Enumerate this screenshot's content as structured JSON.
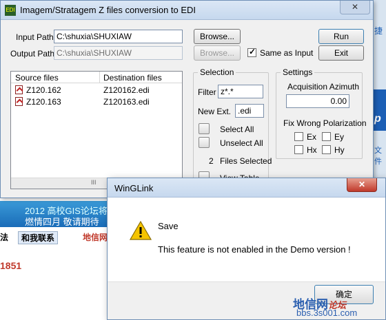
{
  "main_window": {
    "title": "Imagem/Stratagem Z files conversion to EDI",
    "close": "✕",
    "input_path_label": "Input Path",
    "input_path_value": "C:\\shuxia\\SHUXIAW",
    "output_path_label": "Output Path",
    "output_path_value": "C:\\shuxia\\SHUXIAW",
    "browse_input": "Browse...",
    "browse_output": "Browse...",
    "run": "Run",
    "exit": "Exit",
    "same_as_input": "Same as Input",
    "columns": [
      "Source files",
      "Destination files"
    ],
    "files": [
      {
        "source": "Z120.162",
        "dest": "Z120162.edi"
      },
      {
        "source": "Z120.163",
        "dest": "Z120163.edi"
      }
    ],
    "scroll_mark": "III",
    "selection": {
      "title": "Selection",
      "filter_label": "Filter",
      "filter_value": "z*.*",
      "new_ext_label": "New Ext.",
      "new_ext_value": ".edi",
      "select_all": "Select All",
      "unselect_all": "Unselect All",
      "selected_count": "2",
      "files_selected": "Files Selected",
      "view_table": "View Table"
    },
    "settings": {
      "title": "Settings",
      "acq_label": "Acquisition Azimuth",
      "acq_value": "0.00",
      "fix_label": "Fix Wrong Polarization",
      "ex": "Ex",
      "ey": "Ey",
      "hx": "Hx",
      "hy": "Hy"
    }
  },
  "dialog": {
    "title": "WinGLink",
    "close": "✕",
    "heading": "Save",
    "message": "This feature is not enabled in the Demo version !",
    "ok": "确定"
  },
  "background": {
    "banner_line1": "2012 高校GIS论坛将",
    "banner_line2": "燃情四月  敬请期待",
    "link1": "法",
    "link2": "和我联系",
    "link3": "地信网",
    "number": "1851",
    "side_letter1": "捷",
    "side_letter2": "p",
    "side_letter3": "文件",
    "watermark1": "地信网",
    "watermark1_suffix": "论坛",
    "watermark2": "bbs.3s001.com"
  },
  "colors": {
    "accent": "#1c5fb5",
    "close_red": "#c0392b",
    "warning": "#f5c400"
  }
}
